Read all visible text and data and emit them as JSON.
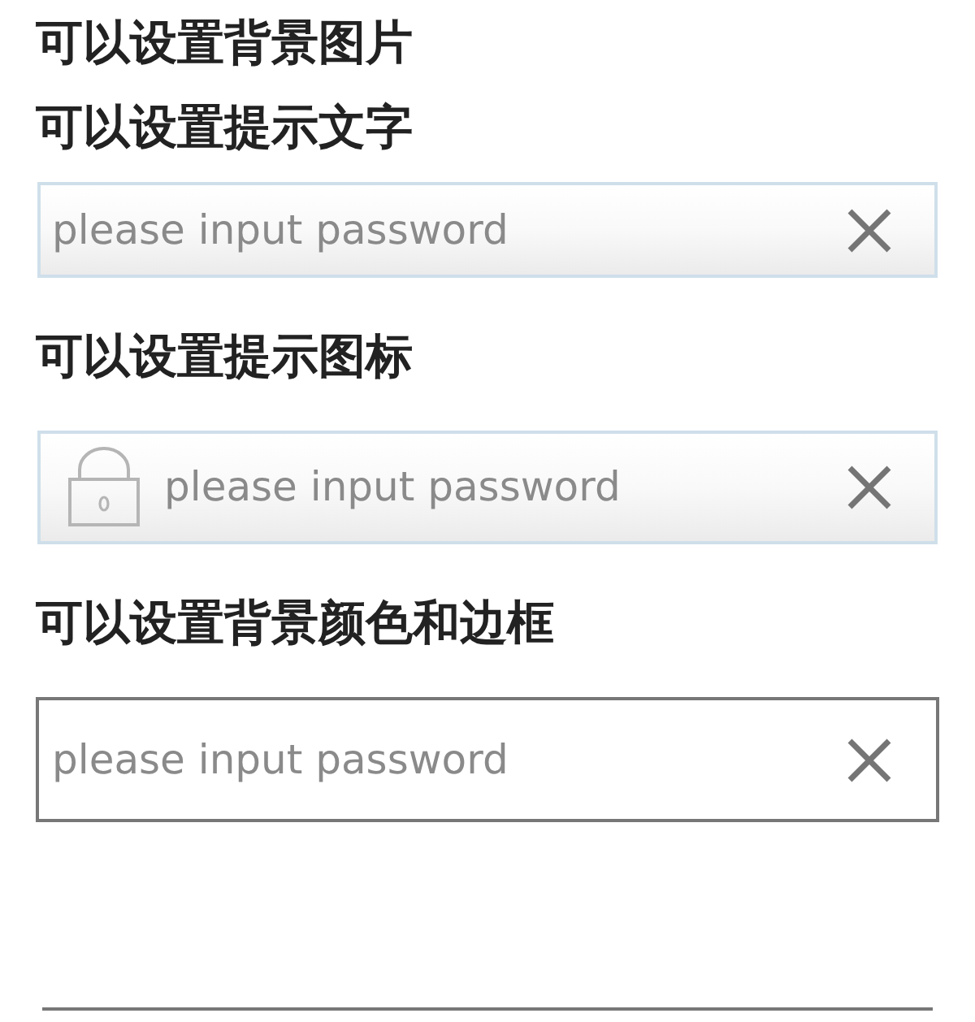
{
  "sections": [
    {
      "heading": "可以设置背景图片"
    },
    {
      "heading": "可以设置提示文字",
      "field": {
        "kind": "image",
        "placeholder": "please input password",
        "clear_button": true
      }
    },
    {
      "heading": "可以设置提示图标",
      "field": {
        "kind": "icon",
        "placeholder": "please input password",
        "clear_button": true
      }
    },
    {
      "heading": "可以设置背景颜色和边框",
      "field": {
        "kind": "bordered",
        "placeholder": "please input password",
        "clear_button": true
      }
    },
    {
      "field": {
        "kind": "underline"
      }
    }
  ]
}
